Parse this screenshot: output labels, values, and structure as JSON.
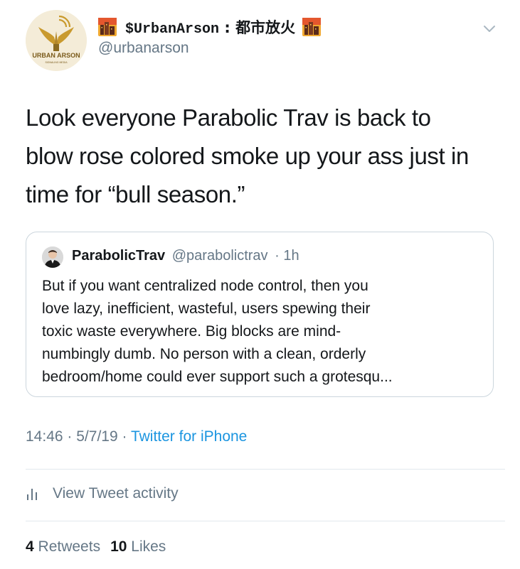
{
  "author": {
    "display_name": "$UrbanArson",
    "separator": ":",
    "display_name_cjk": "都市放火",
    "handle": "@urbanarson",
    "avatar_text": "URBAN ARSON",
    "avatar_subtext": "SIGNALING MEDIA"
  },
  "tweet": {
    "text_line1": "Look everyone Parabolic Trav is back to",
    "text_line2": "blow rose colored smoke up your ass just in",
    "text_line3": "time for “bull season.”"
  },
  "quote": {
    "name": "ParabolicTrav",
    "handle": "@parabolictrav",
    "time": "· 1h",
    "text_line1": "But if you want centralized node control, then you",
    "text_line2": "love lazy, inefficient, wasteful, users spewing their",
    "text_line3": "toxic waste everywhere. Big blocks are mind-",
    "text_line4": "numbingly dumb. No person with a clean, orderly",
    "text_line5": "bedroom/home could ever support such a grotesqu..."
  },
  "meta": {
    "time": "14:46",
    "sep1": "·",
    "date": "5/7/19",
    "sep2": "·",
    "source": "Twitter for iPhone"
  },
  "activity": {
    "label": "View Tweet activity"
  },
  "stats": {
    "retweets_count": "4",
    "retweets_label": "Retweets",
    "likes_count": "10",
    "likes_label": "Likes"
  },
  "colors": {
    "text": "#14171a",
    "secondary": "#657786",
    "link": "#1b95e0",
    "border": "#ccd6dd",
    "avatar_bg": "#f4ecd8",
    "avatar_gold": "#c99a2e"
  },
  "icons": {
    "caret": "chevron-down-icon",
    "activity": "bar-chart-icon",
    "name_emoji": "cityscape-at-dusk-icon"
  }
}
